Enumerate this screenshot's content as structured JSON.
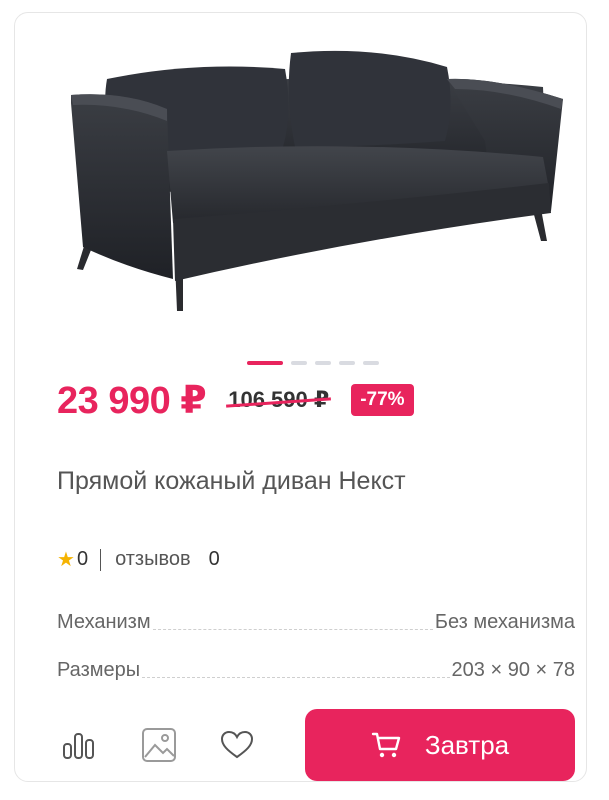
{
  "product": {
    "price": "23 990 ₽",
    "old_price": "106 590 ₽",
    "discount": "-77%",
    "title": "Прямой кожаный диван Некст",
    "rating_value": "0",
    "reviews_label": "отзывов",
    "reviews_count": "0",
    "image_icon": "sofa-photo",
    "gallery": {
      "total": 5,
      "active_index": 0
    }
  },
  "specs": [
    {
      "label": "Механизм",
      "value": "Без механизма"
    },
    {
      "label": "Размеры",
      "value": "203 × 90 × 78"
    }
  ],
  "actions": {
    "compare_icon": "bar-chart-icon",
    "gallery_icon": "image-icon",
    "favorite_icon": "heart-icon",
    "cart_label": "Завтра",
    "cart_icon": "cart-icon"
  },
  "colors": {
    "accent": "#e8245d",
    "star": "#f5b301"
  }
}
